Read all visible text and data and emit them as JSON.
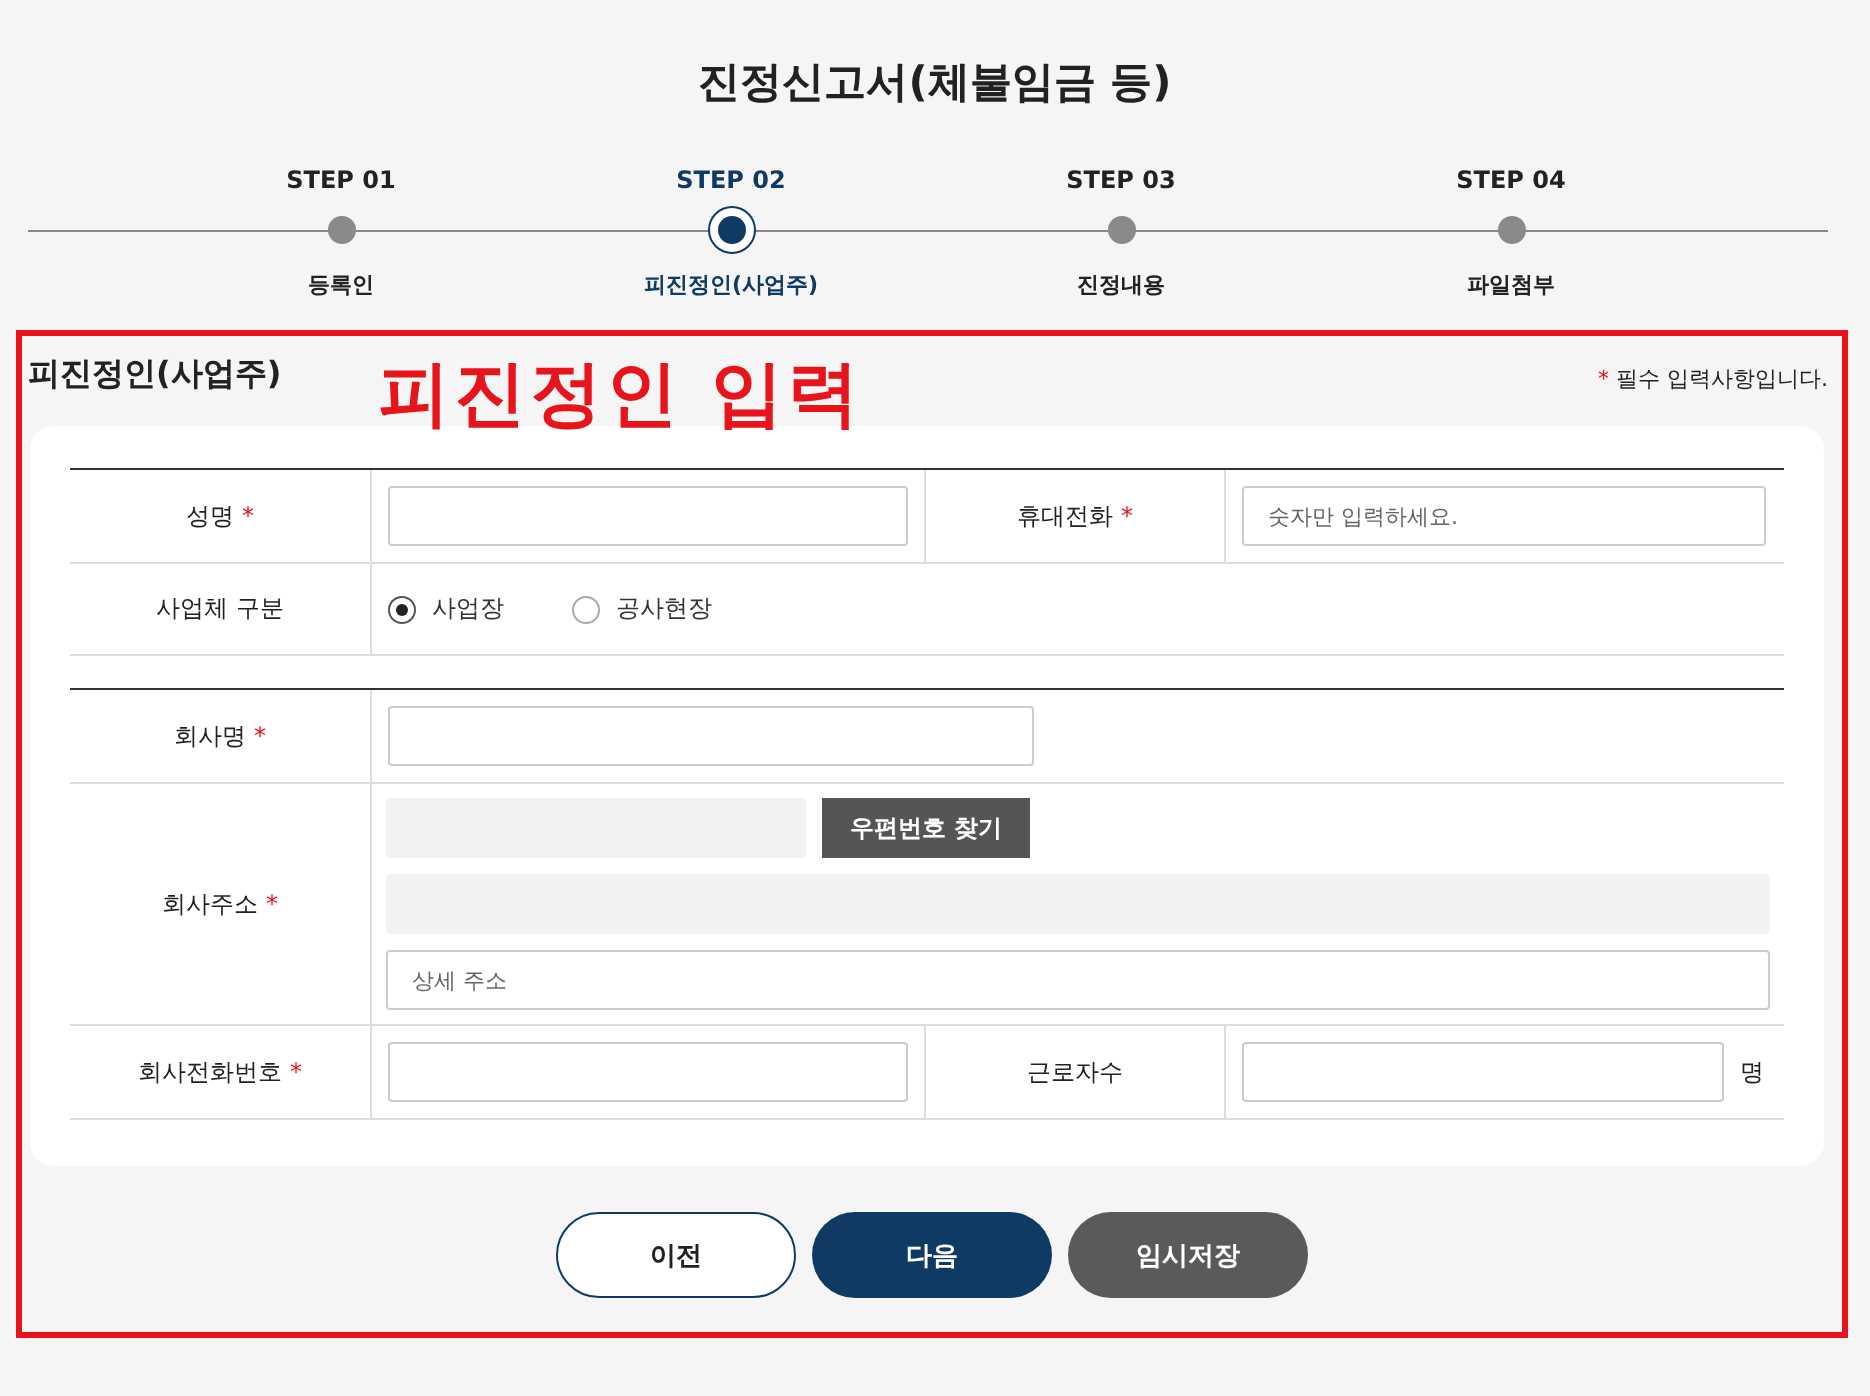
{
  "title": "진정신고서(체불임금 등)",
  "steps": [
    {
      "step": "STEP 01",
      "label": "등록인",
      "selected": false
    },
    {
      "step": "STEP 02",
      "label": "피진정인(사업주)",
      "selected": true
    },
    {
      "step": "STEP 03",
      "label": "진정내용",
      "selected": false
    },
    {
      "step": "STEP 04",
      "label": "파일첨부",
      "selected": false
    }
  ],
  "section": {
    "title": "피진정인(사업주)",
    "note_mark": "*",
    "note": "필수 입력사항입니다.",
    "annotation": "피진정인 입력"
  },
  "forms": [
    [
      {
        "kind": "pair",
        "label": {
          "text": "성명",
          "mark": "*"
        },
        "label2": {
          "text": "휴대전화",
          "mark": "*"
        },
        "placeholder2": "숫자만 입력하세요."
      },
      {
        "kind": "radio",
        "label": {
          "text": "사업체 구분"
        },
        "options": [
          {
            "label": "사업장",
            "selected": true
          },
          {
            "label": "공사현장",
            "selected": false
          }
        ]
      }
    ],
    [
      {
        "kind": "single",
        "label": {
          "text": "회사명",
          "mark": "*"
        }
      },
      {
        "kind": "address",
        "label": {
          "text": "회사주소",
          "mark": "*"
        },
        "button": "우편번호 찾기",
        "detail_placeholder": "상세 주소"
      },
      {
        "kind": "pair",
        "label": {
          "text": "회사전화번호",
          "mark": "*"
        },
        "label2": {
          "text": "근로자수"
        },
        "unit": "명"
      }
    ]
  ],
  "buttons": [
    {
      "label": "이전",
      "kind": "outline"
    },
    {
      "label": "다음",
      "kind": "primary"
    },
    {
      "label": "임시저장",
      "kind": "secondary"
    }
  ]
}
